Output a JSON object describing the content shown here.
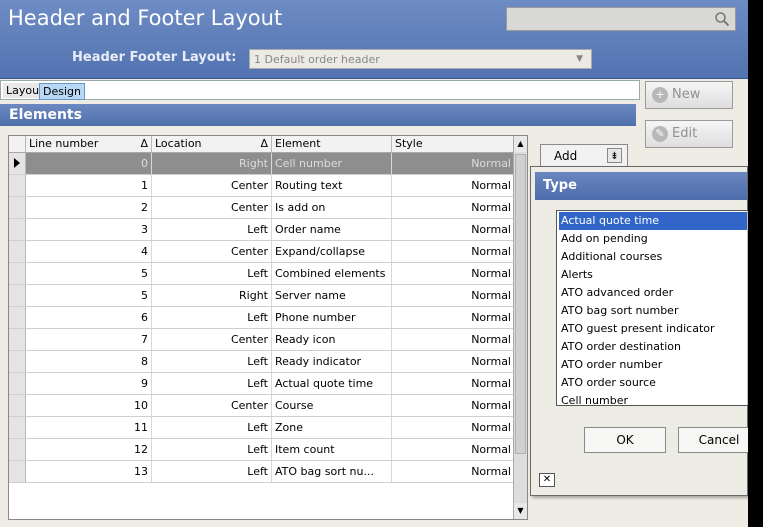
{
  "window": {
    "title": "Header and Footer Layout"
  },
  "search": {
    "placeholder": ""
  },
  "layout_selector": {
    "label": "Header Footer Layout:",
    "value": "1 Default order header"
  },
  "tabs": [
    {
      "label": "Layout"
    },
    {
      "label": "Design"
    }
  ],
  "elements_section": {
    "title": "Elements"
  },
  "grid": {
    "columns": [
      "Line number",
      "Location",
      "Element",
      "Style"
    ],
    "rows": [
      {
        "line": "0",
        "location": "Right",
        "element": "Cell number",
        "style": "Normal",
        "selected": true
      },
      {
        "line": "1",
        "location": "Center",
        "element": "Routing text",
        "style": "Normal"
      },
      {
        "line": "2",
        "location": "Center",
        "element": "Is add on",
        "style": "Normal"
      },
      {
        "line": "3",
        "location": "Left",
        "element": "Order name",
        "style": "Normal"
      },
      {
        "line": "4",
        "location": "Center",
        "element": "Expand/collapse",
        "style": "Normal"
      },
      {
        "line": "5",
        "location": "Left",
        "element": "Combined elements",
        "style": "Normal"
      },
      {
        "line": "5",
        "location": "Right",
        "element": "Server name",
        "style": "Normal"
      },
      {
        "line": "6",
        "location": "Left",
        "element": "Phone number",
        "style": "Normal"
      },
      {
        "line": "7",
        "location": "Center",
        "element": "Ready icon",
        "style": "Normal"
      },
      {
        "line": "8",
        "location": "Left",
        "element": "Ready indicator",
        "style": "Normal"
      },
      {
        "line": "9",
        "location": "Left",
        "element": "Actual quote time",
        "style": "Normal"
      },
      {
        "line": "10",
        "location": "Center",
        "element": "Course",
        "style": "Normal"
      },
      {
        "line": "11",
        "location": "Left",
        "element": "Zone",
        "style": "Normal"
      },
      {
        "line": "12",
        "location": "Left",
        "element": "Item count",
        "style": "Normal"
      },
      {
        "line": "13",
        "location": "Left",
        "element": "ATO bag sort nu...",
        "style": "Normal"
      }
    ]
  },
  "side_buttons": {
    "new_label": "New",
    "edit_label": "Edit"
  },
  "add_button": {
    "label": "Add"
  },
  "type_popup": {
    "title": "Type",
    "items": [
      "Actual quote time",
      "Add on pending",
      "Additional courses",
      "Alerts",
      "ATO advanced order",
      "ATO bag sort number",
      "ATO guest present indicator",
      "ATO order destination",
      "ATO order number",
      "ATO order source",
      "Cell number"
    ],
    "selected": "Actual quote time",
    "ok_label": "OK",
    "cancel_label": "Cancel"
  },
  "colors": {
    "title_bar": "#5b7bb9",
    "section_header": "#5d7cb8",
    "list_selection": "#3166c8",
    "grid_selected_row": "#8e8e8e"
  }
}
